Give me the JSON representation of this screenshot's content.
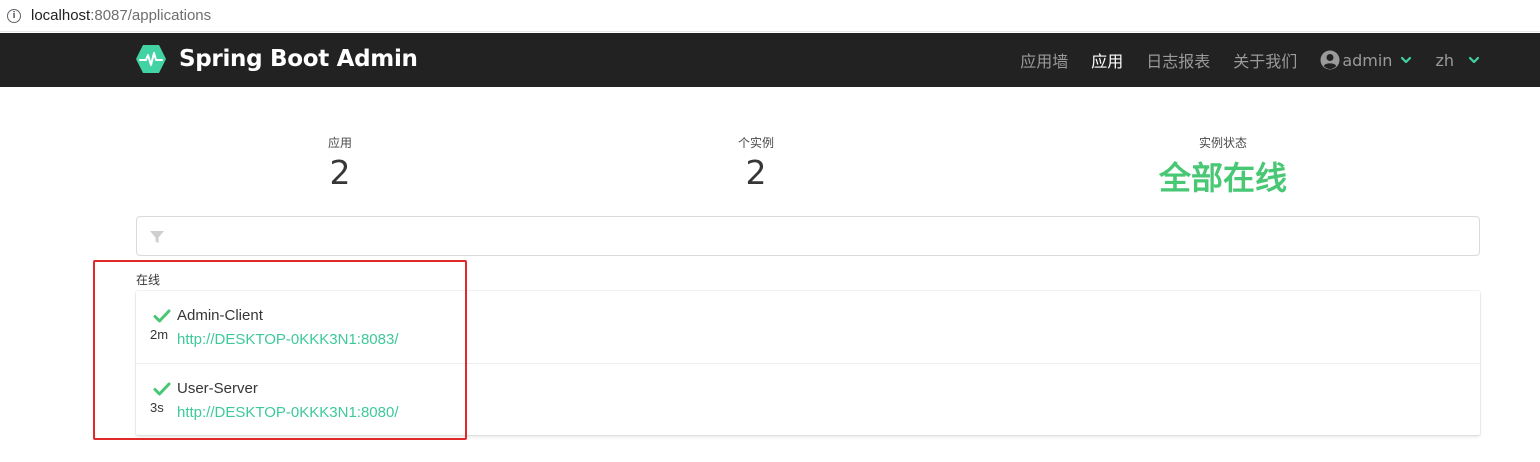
{
  "browser": {
    "url_host": "localhost",
    "url_rest": ":8087/applications"
  },
  "navbar": {
    "brand_title": "Spring Boot Admin",
    "items": [
      {
        "label": "应用墙",
        "active": false
      },
      {
        "label": "应用",
        "active": true
      },
      {
        "label": "日志报表",
        "active": false
      },
      {
        "label": "关于我们",
        "active": false
      }
    ],
    "user": "admin",
    "language": "zh"
  },
  "stats": {
    "applications_label": "应用",
    "applications_value": "2",
    "instances_label": "个实例",
    "instances_value": "2",
    "status_label": "实例状态",
    "status_value": "全部在线"
  },
  "filter": {
    "placeholder": "",
    "value": ""
  },
  "group": {
    "label": "在线"
  },
  "applications": [
    {
      "name": "Admin-Client",
      "since": "2m",
      "url": "http://DESKTOP-0KKK3N1:8083/"
    },
    {
      "name": "User-Server",
      "since": "3s",
      "url": "http://DESKTOP-0KKK3N1:8080/"
    }
  ],
  "colors": {
    "navbar_bg": "#222222",
    "brand_accent": "#42d3a5",
    "status_ok": "#48c774",
    "highlight": "#e0292b"
  },
  "icons": {
    "address": "info-icon",
    "brand": "heartbeat-logo-icon",
    "user": "user-circle-icon",
    "dropdown": "chevron-down-icon",
    "filter": "filter-icon",
    "status": "check-icon"
  }
}
